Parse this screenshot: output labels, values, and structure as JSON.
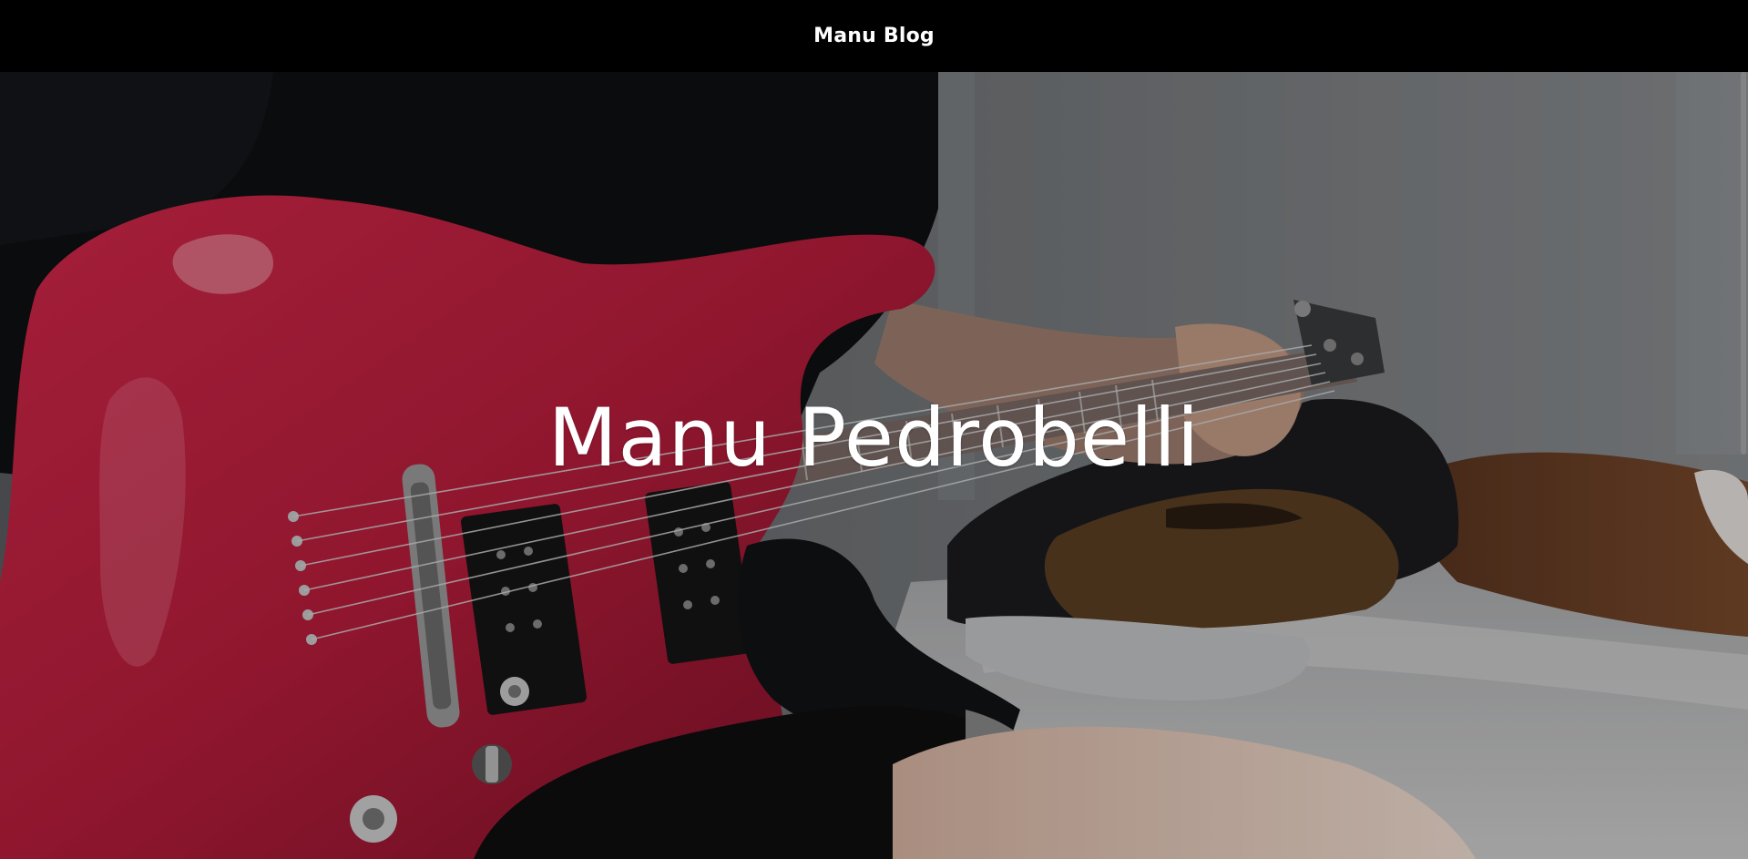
{
  "header": {
    "brand": "Manu Blog"
  },
  "hero": {
    "title": "Manu Pedrobelli",
    "background": "photo of a person playing a red electric guitar"
  },
  "colors": {
    "header_bg": "#000000",
    "text": "#ffffff",
    "guitar": "#c0223f",
    "wall": "#6f7276"
  }
}
